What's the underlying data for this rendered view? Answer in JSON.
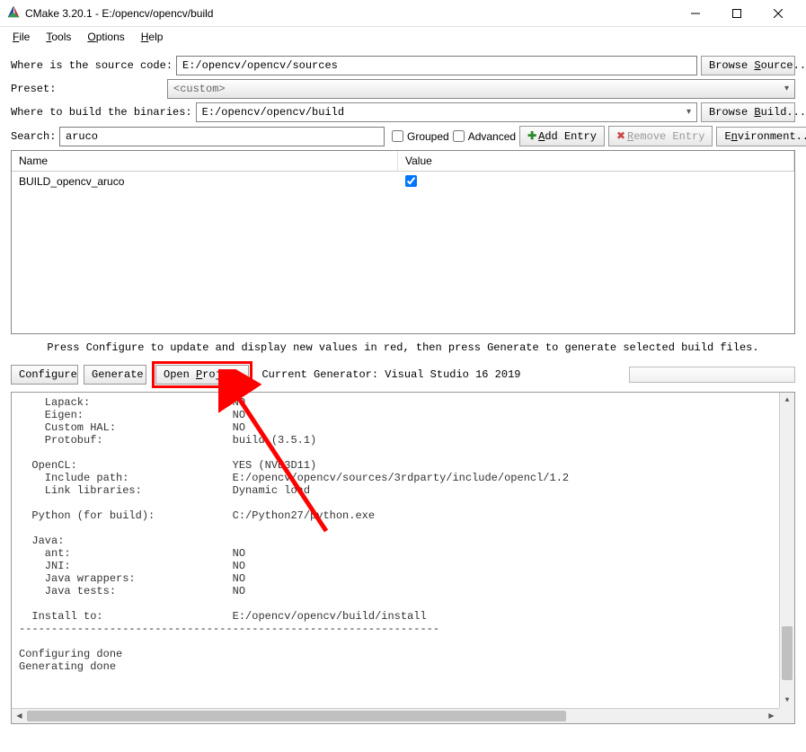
{
  "window": {
    "title": "CMake 3.20.1 - E:/opencv/opencv/build"
  },
  "menu": {
    "file": "File",
    "tools": "Tools",
    "options": "Options",
    "help": "Help"
  },
  "labels": {
    "source": "Where is the source code:",
    "preset": "Preset:",
    "build": "Where to build the binaries:",
    "search": "Search:",
    "grouped": "Grouped",
    "advanced": "Advanced",
    "browse_source": "Browse Source...",
    "browse_build": "Browse Build..."
  },
  "inputs": {
    "source": "E:/opencv/opencv/sources",
    "preset": "<custom>",
    "build": "E:/opencv/opencv/build",
    "search": "aruco"
  },
  "buttons": {
    "add_entry": "Add Entry",
    "remove_entry": "Remove Entry",
    "environment": "Environment...",
    "configure": "Configure",
    "generate": "Generate",
    "open_project": "Open Project"
  },
  "generator": "Current Generator: Visual Studio 16 2019",
  "table": {
    "headers": {
      "name": "Name",
      "value": "Value"
    },
    "rows": [
      {
        "name": "BUILD_opencv_aruco",
        "checked": true
      }
    ]
  },
  "hint": "Press Configure to update and display new values in red, then press Generate to generate selected build files.",
  "output_lines": [
    "    Lapack:                      NO",
    "    Eigen:                       NO",
    "    Custom HAL:                  NO",
    "    Protobuf:                    build (3.5.1)",
    "",
    "  OpenCL:                        YES (NVD3D11)",
    "    Include path:                E:/opencv/opencv/sources/3rdparty/include/opencl/1.2",
    "    Link libraries:              Dynamic load",
    "",
    "  Python (for build):            C:/Python27/python.exe",
    "",
    "  Java:",
    "    ant:                         NO",
    "    JNI:                         NO",
    "    Java wrappers:               NO",
    "    Java tests:                  NO",
    "",
    "  Install to:                    E:/opencv/opencv/build/install",
    "-----------------------------------------------------------------",
    "",
    "Configuring done",
    "Generating done"
  ]
}
